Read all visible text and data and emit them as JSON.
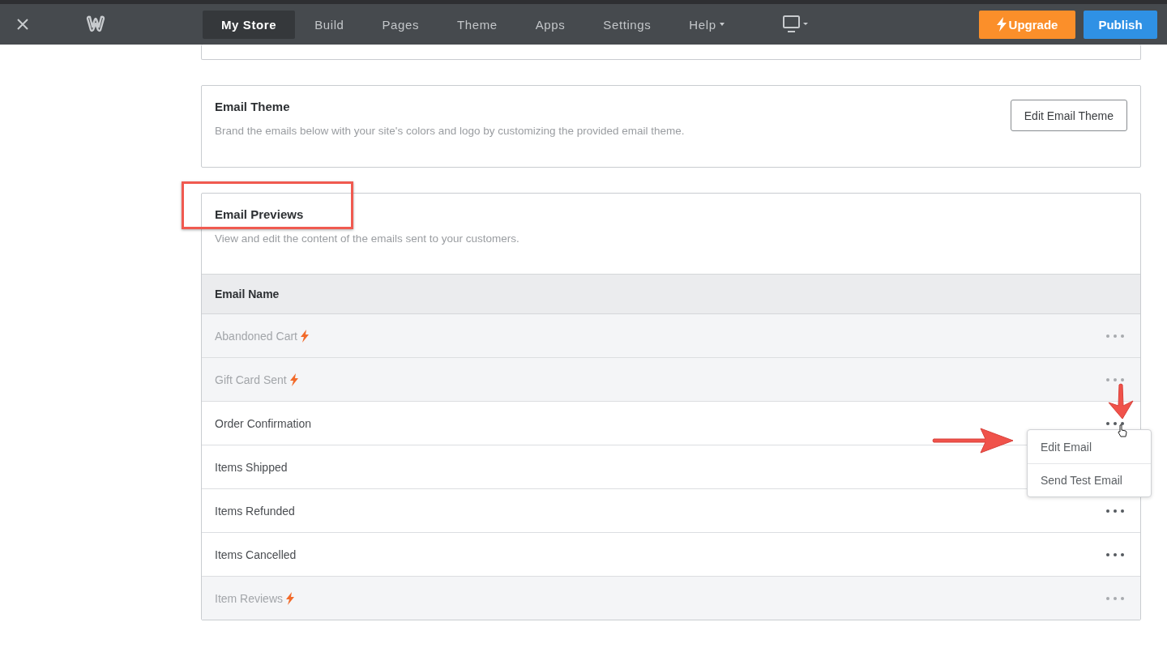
{
  "topbar": {
    "tabs": [
      {
        "label": "My Store",
        "selected": true,
        "kind": "plain"
      },
      {
        "label": "Build",
        "selected": false,
        "kind": "plain"
      },
      {
        "label": "Pages",
        "selected": false,
        "kind": "plain"
      },
      {
        "label": "Theme",
        "selected": false,
        "kind": "plain"
      },
      {
        "label": "Apps",
        "selected": false,
        "kind": "plain"
      },
      {
        "label": "Settings",
        "selected": false,
        "kind": "plain"
      },
      {
        "label": "Help",
        "selected": false,
        "kind": "dropdown"
      }
    ],
    "upgrade_button": "Upgrade",
    "publish_button": "Publish"
  },
  "email_theme": {
    "title": "Email Theme",
    "description": "Brand the emails below with your site's colors and logo by customizing the provided email theme.",
    "button": "Edit Email Theme"
  },
  "email_previews": {
    "title": "Email Previews",
    "description": "View and edit the content of the emails sent to your customers.",
    "column": "Email Name",
    "rows": [
      {
        "name": "Abandoned Cart",
        "premium": true,
        "menu_open": false
      },
      {
        "name": "Gift Card Sent",
        "premium": true,
        "menu_open": false
      },
      {
        "name": "Order Confirmation",
        "premium": false,
        "menu_open": true
      },
      {
        "name": "Items Shipped",
        "premium": false,
        "menu_open": false
      },
      {
        "name": "Items Refunded",
        "premium": false,
        "menu_open": false
      },
      {
        "name": "Items Cancelled",
        "premium": false,
        "menu_open": false
      },
      {
        "name": "Item Reviews",
        "premium": true,
        "menu_open": false
      }
    ],
    "row_menu": [
      "Edit Email",
      "Send Test Email"
    ]
  }
}
